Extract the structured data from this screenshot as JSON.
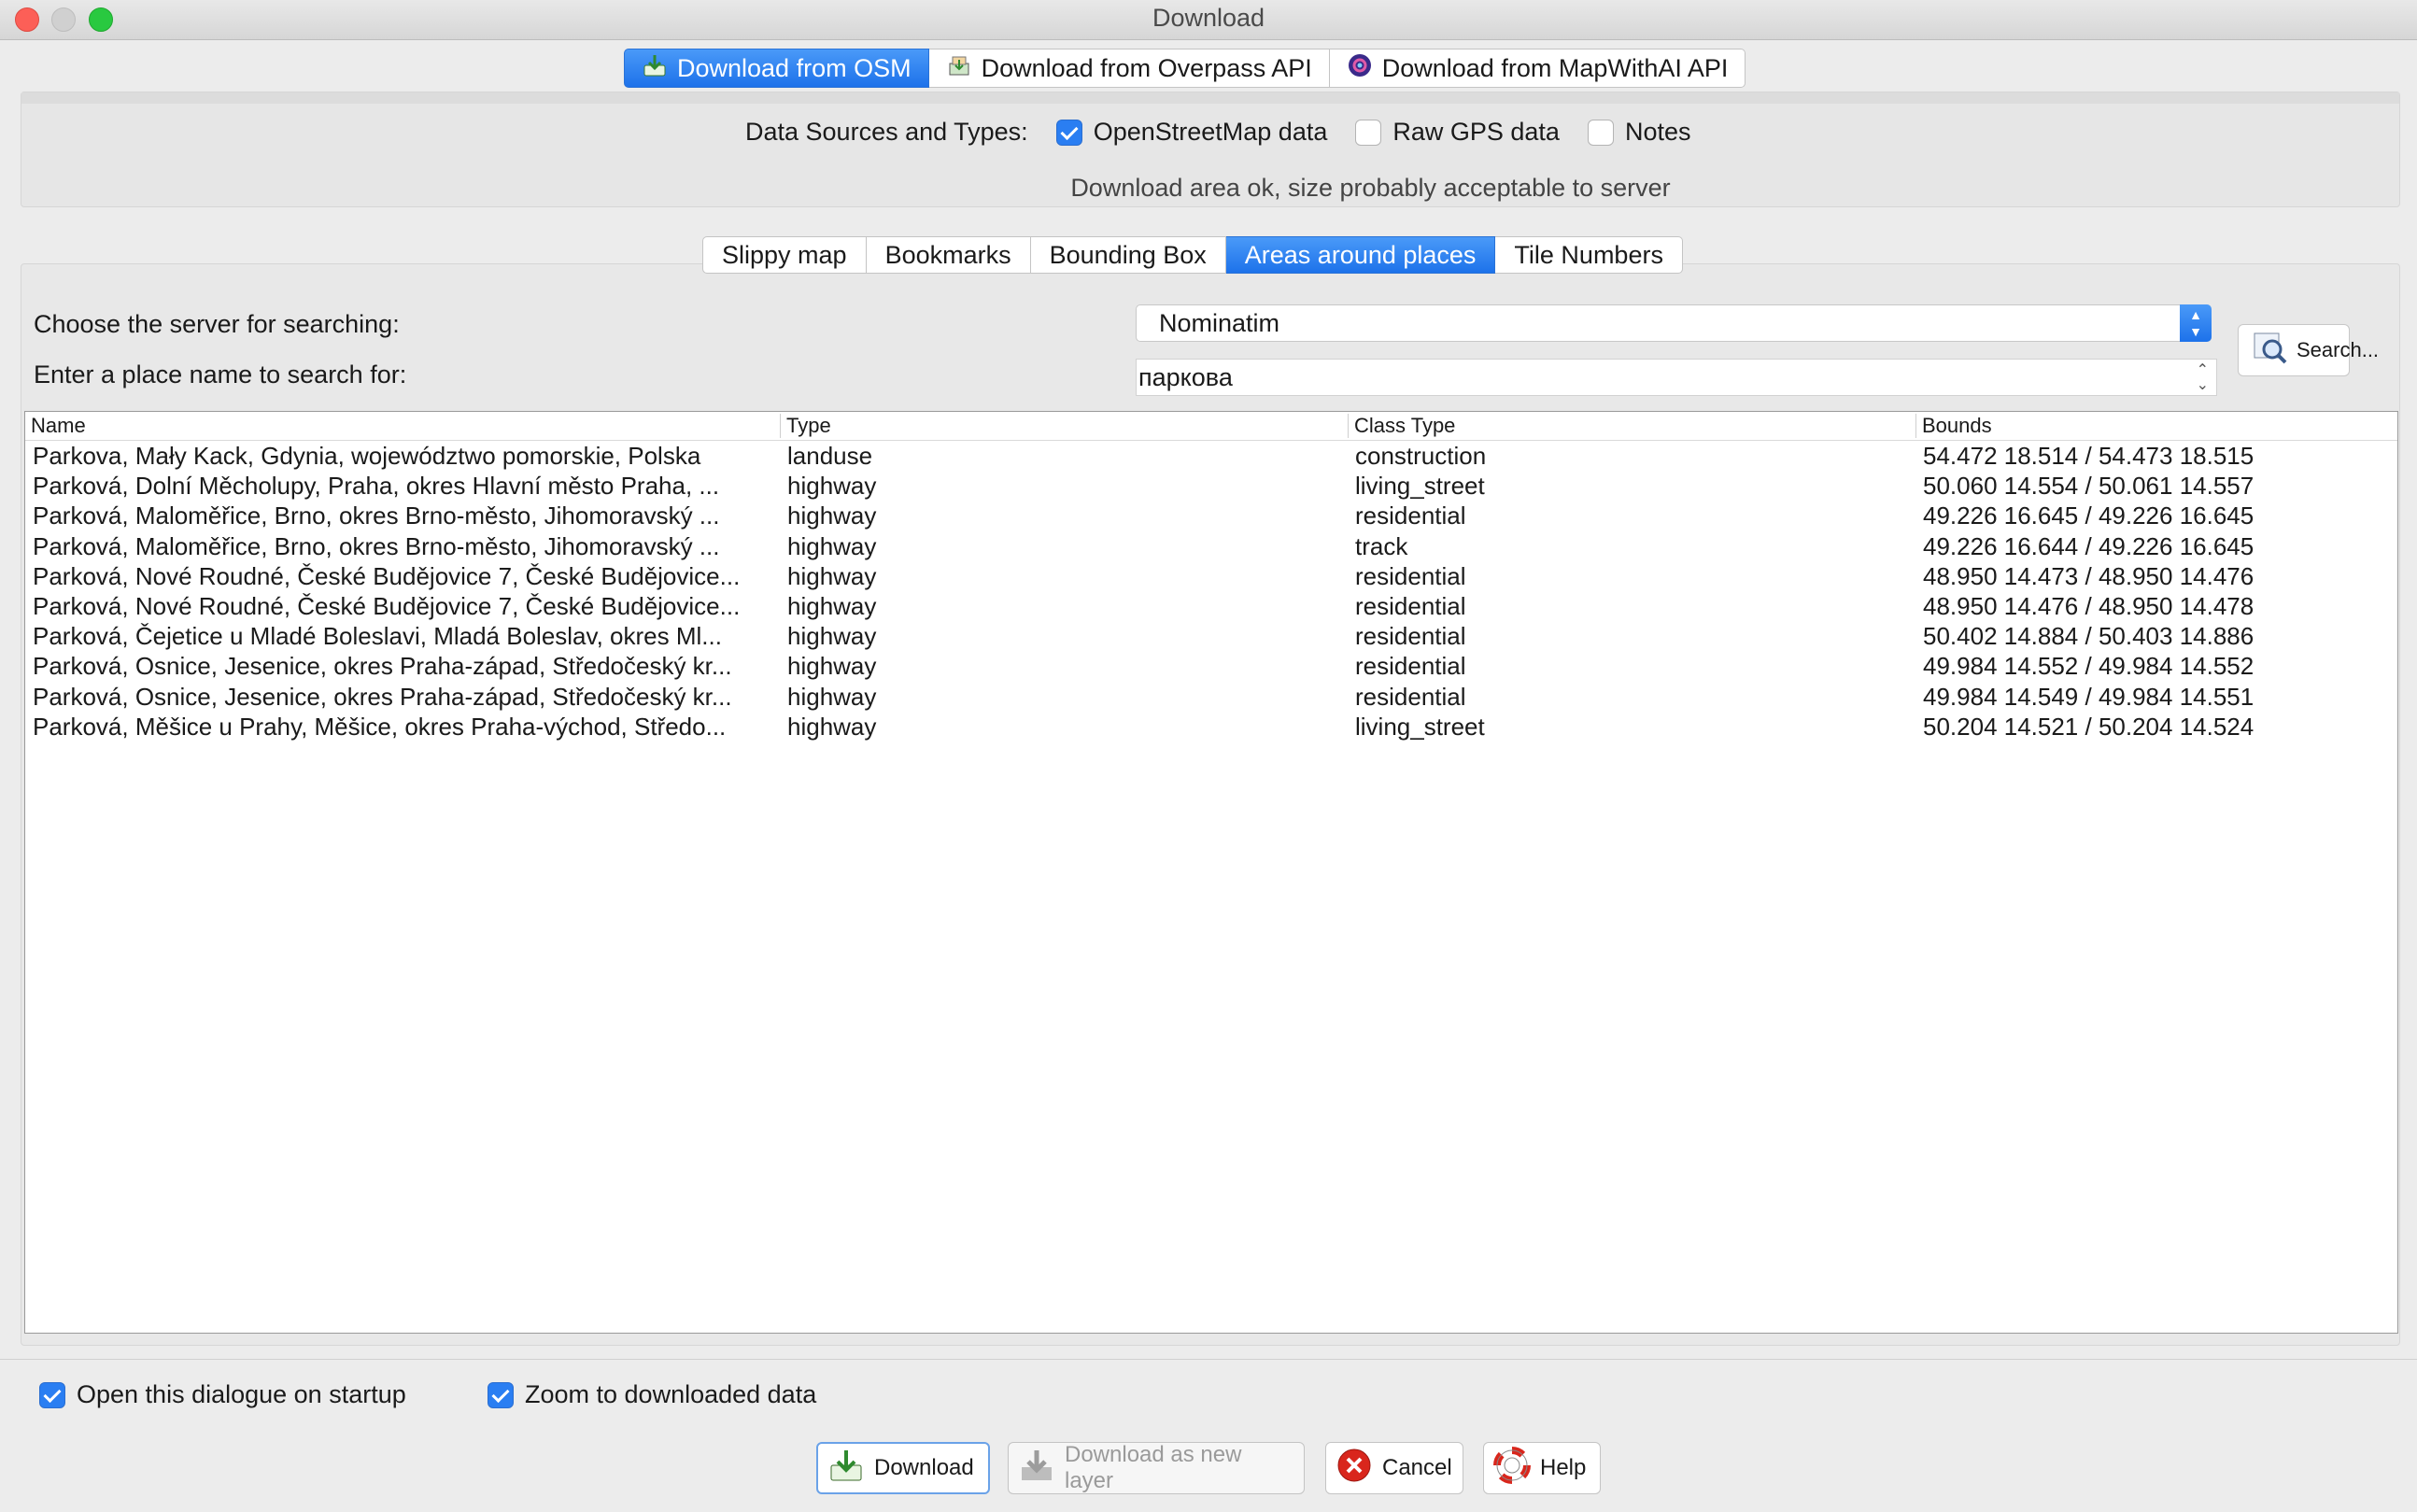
{
  "window": {
    "title": "Download"
  },
  "source_tabs": [
    {
      "label": "Download from OSM",
      "icon": "download-icon",
      "active": true
    },
    {
      "label": "Download from Overpass API",
      "icon": "overpass-icon",
      "active": false
    },
    {
      "label": "Download from MapWithAI API",
      "icon": "mapwithai-icon",
      "active": false
    }
  ],
  "data_sources": {
    "label": "Data Sources and Types:",
    "options": [
      {
        "label": "OpenStreetMap data",
        "checked": true
      },
      {
        "label": "Raw GPS data",
        "checked": false
      },
      {
        "label": "Notes",
        "checked": false
      }
    ],
    "status": "Download area ok, size probably acceptable to server"
  },
  "mode_tabs": [
    {
      "label": "Slippy map",
      "active": false
    },
    {
      "label": "Bookmarks",
      "active": false
    },
    {
      "label": "Bounding Box",
      "active": false
    },
    {
      "label": "Areas around places",
      "active": true
    },
    {
      "label": "Tile Numbers",
      "active": false
    }
  ],
  "search": {
    "server_label": "Choose the server for searching:",
    "server_value": "Nominatim",
    "place_label": "Enter a place name to search for:",
    "place_value": "паркова",
    "button_label": "Search..."
  },
  "table": {
    "headers": [
      "Name",
      "Type",
      "Class Type",
      "Bounds"
    ],
    "rows": [
      [
        "Parkova, Mały Kack, Gdynia, województwo pomorskie, Polska",
        "landuse",
        "construction",
        "54.472 18.514 / 54.473 18.515"
      ],
      [
        "Parková, Dolní Měcholupy, Praha, okres Hlavní město Praha, ...",
        "highway",
        "living_street",
        "50.060 14.554 / 50.061 14.557"
      ],
      [
        "Parková, Maloměřice, Brno, okres Brno-město, Jihomoravský ...",
        "highway",
        "residential",
        "49.226 16.645 / 49.226 16.645"
      ],
      [
        "Parková, Maloměřice, Brno, okres Brno-město, Jihomoravský ...",
        "highway",
        "track",
        "49.226 16.644 / 49.226 16.645"
      ],
      [
        "Parková, Nové Roudné, České Budějovice 7, České Budějovice...",
        "highway",
        "residential",
        "48.950 14.473 / 48.950 14.476"
      ],
      [
        "Parková, Nové Roudné, České Budějovice 7, České Budějovice...",
        "highway",
        "residential",
        "48.950 14.476 / 48.950 14.478"
      ],
      [
        "Parková, Čejetice u Mladé Boleslavi, Mladá Boleslav, okres Ml...",
        "highway",
        "residential",
        "50.402 14.884 / 50.403 14.886"
      ],
      [
        "Parková, Osnice, Jesenice, okres Praha-západ, Středočeský kr...",
        "highway",
        "residential",
        "49.984 14.552 / 49.984 14.552"
      ],
      [
        "Parková, Osnice, Jesenice, okres Praha-západ, Středočeský kr...",
        "highway",
        "residential",
        "49.984 14.549 / 49.984 14.551"
      ],
      [
        "Parková, Měšice u Prahy, Měšice, okres Praha-východ, Středo...",
        "highway",
        "living_street",
        "50.204 14.521 / 50.204 14.524"
      ]
    ]
  },
  "options": {
    "open_on_startup": {
      "label": "Open this dialogue on startup",
      "checked": true
    },
    "zoom_to_data": {
      "label": "Zoom to downloaded data",
      "checked": true
    }
  },
  "buttons": {
    "download": "Download",
    "download_new_layer": "Download as new layer",
    "cancel": "Cancel",
    "help": "Help"
  },
  "colors": {
    "accent": "#1d72ea",
    "cancel_red": "#d9261c"
  }
}
